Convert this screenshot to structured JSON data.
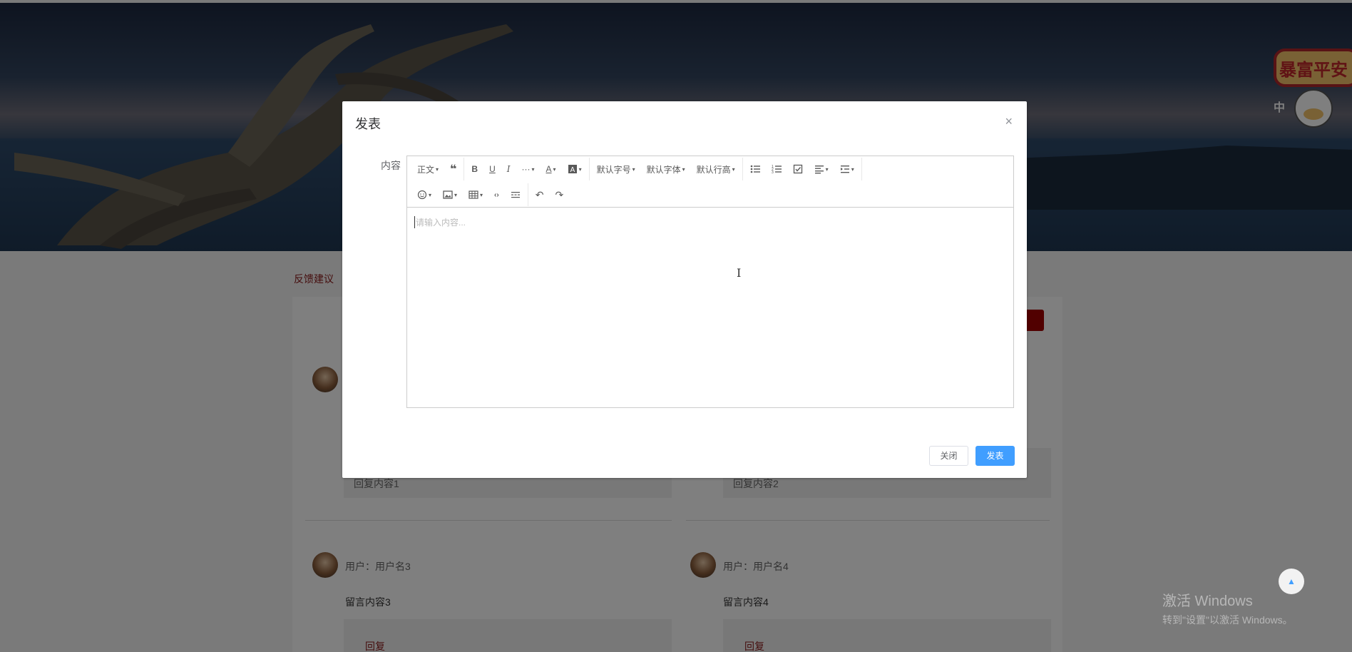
{
  "page": {
    "breadcrumb": "反馈建议",
    "messages": [
      {
        "user": "用户：用户名3",
        "content": "留言内容3",
        "reply_label": "回复"
      },
      {
        "user": "用户：用户名4",
        "content": "留言内容4",
        "reply_label": "回复"
      }
    ],
    "replies": [
      {
        "text": "回复内容1"
      },
      {
        "text": "回复内容2"
      }
    ]
  },
  "sticker": {
    "text": "暴富平安",
    "badge": "中"
  },
  "dialog": {
    "title": "发表",
    "close_icon": "×",
    "field_label": "内容",
    "placeholder": "请输入内容...",
    "toolbar": {
      "row1": [
        "正文",
        "引用",
        "B",
        "U",
        "I",
        "···",
        "A",
        "背景色",
        "默认字号",
        "默认字体",
        "默认行高",
        "无序列表",
        "有序列表",
        "待办",
        "对齐",
        "缩进"
      ],
      "row2": [
        "表情",
        "图片",
        "表格",
        "代码",
        "分割线",
        "撤销",
        "重做"
      ]
    },
    "close_button": "关闭",
    "publish_button": "发表"
  },
  "os": {
    "activate_title": "激活 Windows",
    "activate_sub": "转到\"设置\"以激活 Windows。"
  },
  "back_top_icon": "▲"
}
